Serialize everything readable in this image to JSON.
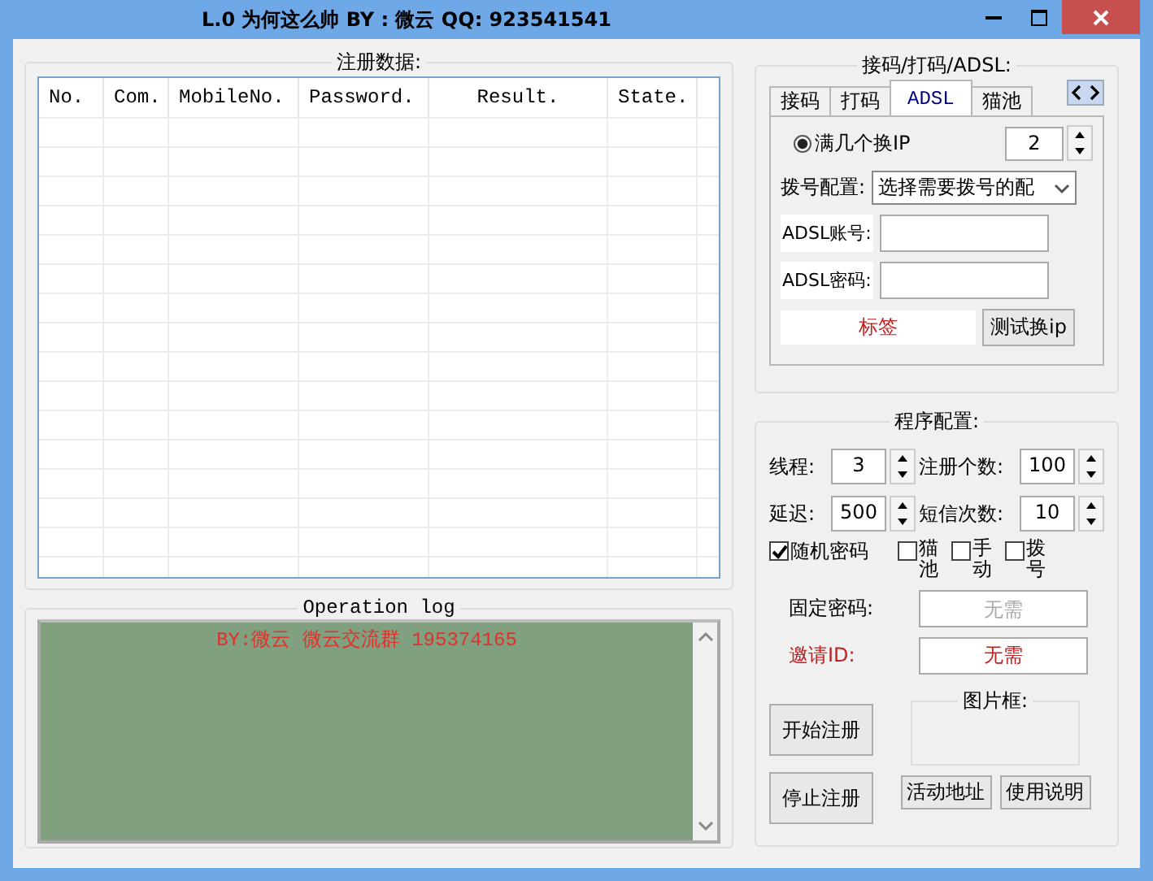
{
  "window": {
    "title": "L.0 为何这么帅 BY : 微云 QQ: 923541541"
  },
  "table": {
    "title": "注册数据:",
    "columns": [
      "No.",
      "Com.",
      "MobileNo.",
      "Password.",
      "Result.",
      "State."
    ]
  },
  "log": {
    "title": "Operation log",
    "lines": [
      "BY:微云   微云交流群 195374165"
    ]
  },
  "dial_group": {
    "title": "接码/打码/ADSL:",
    "tabs": [
      {
        "label": "接码",
        "selected": false
      },
      {
        "label": "打码",
        "selected": false
      },
      {
        "label": "ADSL",
        "selected": true
      },
      {
        "label": "猫池",
        "selected": false
      }
    ],
    "adsl": {
      "radio": {
        "label": "满几个换IP",
        "selected": true
      },
      "switch_count": "2",
      "config_label": "拨号配置:",
      "config_value": "选择需要拨号的配",
      "account_label": "ADSL账号:",
      "password_label": "ADSL密码:",
      "tag_label": "标签",
      "test_button": "测试换ip"
    }
  },
  "program_group": {
    "title": "程序配置:",
    "spins": [
      {
        "label": "线程:",
        "value": "3"
      },
      {
        "label": "注册个数:",
        "value": "100"
      },
      {
        "label": "延迟:",
        "value": "500"
      },
      {
        "label": "短信次数:",
        "value": "10"
      }
    ],
    "checkboxes": [
      {
        "label": "随机密码",
        "checked": true,
        "kind": "inline"
      },
      {
        "label": "猫池",
        "checked": false,
        "kind": "stacked"
      },
      {
        "label": "手动",
        "checked": false,
        "kind": "stacked"
      },
      {
        "label": "拨号",
        "checked": false,
        "kind": "stacked"
      }
    ],
    "fixed_password": {
      "label": "固定密码:",
      "placeholder": "无需"
    },
    "invite": {
      "label": "邀请ID:",
      "value": "无需"
    },
    "start_button": "开始注册",
    "stop_button": "停止注册",
    "picture_box": {
      "title": "图片框:"
    },
    "link_buttons": [
      "活动地址",
      "使用说明"
    ]
  }
}
